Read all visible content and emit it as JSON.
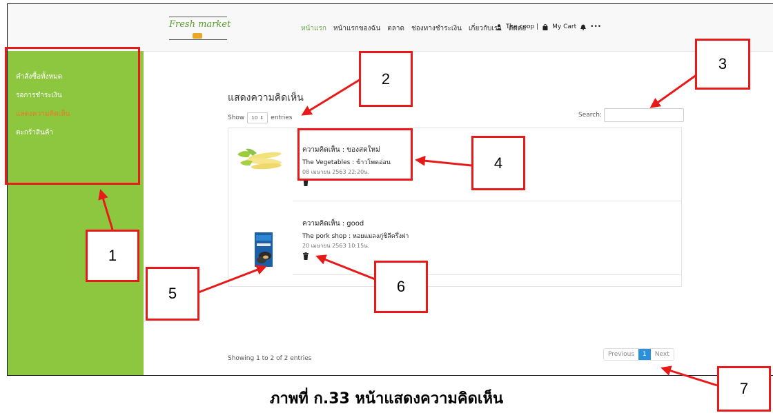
{
  "navbar": {
    "logo_text": "Fresh market",
    "links": [
      "หน้าแรก",
      "หน้าแรกของฉัน",
      "ตลาด",
      "ช่องทางชำระเงิน",
      "เกี่ยวกับเรา",
      "ติดต่อ"
    ],
    "active_link": "หน้าแรก",
    "user_label": "The coop |",
    "cart_label": "My Cart",
    "more_label": "•••"
  },
  "sidebar": {
    "items": [
      {
        "label": "คำสั่งซื้อทั้งหมด"
      },
      {
        "label": "รอการชำระเงิน"
      },
      {
        "label": "แสดงความคิดเห็น"
      },
      {
        "label": "ตะกร้าสินค้า"
      }
    ],
    "active_item": "แสดงความคิดเห็น"
  },
  "main": {
    "title": "แสดงความคิดเห็น",
    "show_label": "Show",
    "entries_value": "10",
    "entries_label": "entries",
    "search_label": "Search:",
    "search_value": "",
    "comments": [
      {
        "comment": "ความคิดเห็น : ของสดใหม่",
        "product": "The Vegetables : ข้าวโพดอ่อน",
        "date": "08 เมษายน 2563 22:20น."
      },
      {
        "comment": "ความคิดเห็น : good",
        "product": "The pork shop : หอยแมลงภู่ชิลีครึ่งฝา",
        "date": "20 เมษายน 2563 10:15น."
      }
    ],
    "footer_info": "Showing 1 to 2 of 2 entries",
    "pagination": {
      "previous": "Previous",
      "current": "1",
      "next": "Next"
    }
  },
  "annotations": [
    "1",
    "2",
    "3",
    "4",
    "5",
    "6",
    "7"
  ],
  "caption": "ภาพที่ ก.33 หน้าแสดงความคิดเห็น",
  "colors": {
    "sidebar_bg": "#8dc63f",
    "sidebar_active": "#e67e22",
    "nav_active": "#6aa84f",
    "annotation_red": "#e81919",
    "pager_active": "#2b8fd9"
  }
}
